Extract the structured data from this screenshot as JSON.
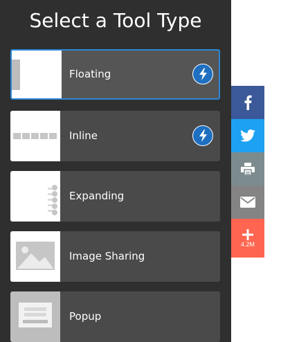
{
  "panel": {
    "title": "Select a Tool Type"
  },
  "tools": [
    {
      "label": "Floating",
      "selected": true,
      "has_bolt": true,
      "icon": "floating-preview"
    },
    {
      "label": "Inline",
      "selected": false,
      "has_bolt": true,
      "icon": "inline-preview"
    },
    {
      "label": "Expanding",
      "selected": false,
      "has_bolt": false,
      "icon": "expanding-preview"
    },
    {
      "label": "Image Sharing",
      "selected": false,
      "has_bolt": false,
      "icon": "image-preview"
    },
    {
      "label": "Popup",
      "selected": false,
      "has_bolt": false,
      "icon": "popup-preview"
    }
  ],
  "share_bar": {
    "buttons": [
      {
        "network": "facebook",
        "icon": "facebook-icon",
        "color": "#3b5998"
      },
      {
        "network": "twitter",
        "icon": "twitter-icon",
        "color": "#1da1f2"
      },
      {
        "network": "print",
        "icon": "print-icon",
        "color": "#7c8b8d"
      },
      {
        "network": "email",
        "icon": "email-icon",
        "color": "#848484"
      },
      {
        "network": "more",
        "icon": "plus-icon",
        "color": "#ff6550",
        "count": "4.2M"
      }
    ]
  },
  "colors": {
    "panel_bg": "#2f2f2f",
    "card_bg": "#4a4a4a",
    "selected_border": "#2b87d6",
    "bolt_bg": "#1f6fc0"
  }
}
